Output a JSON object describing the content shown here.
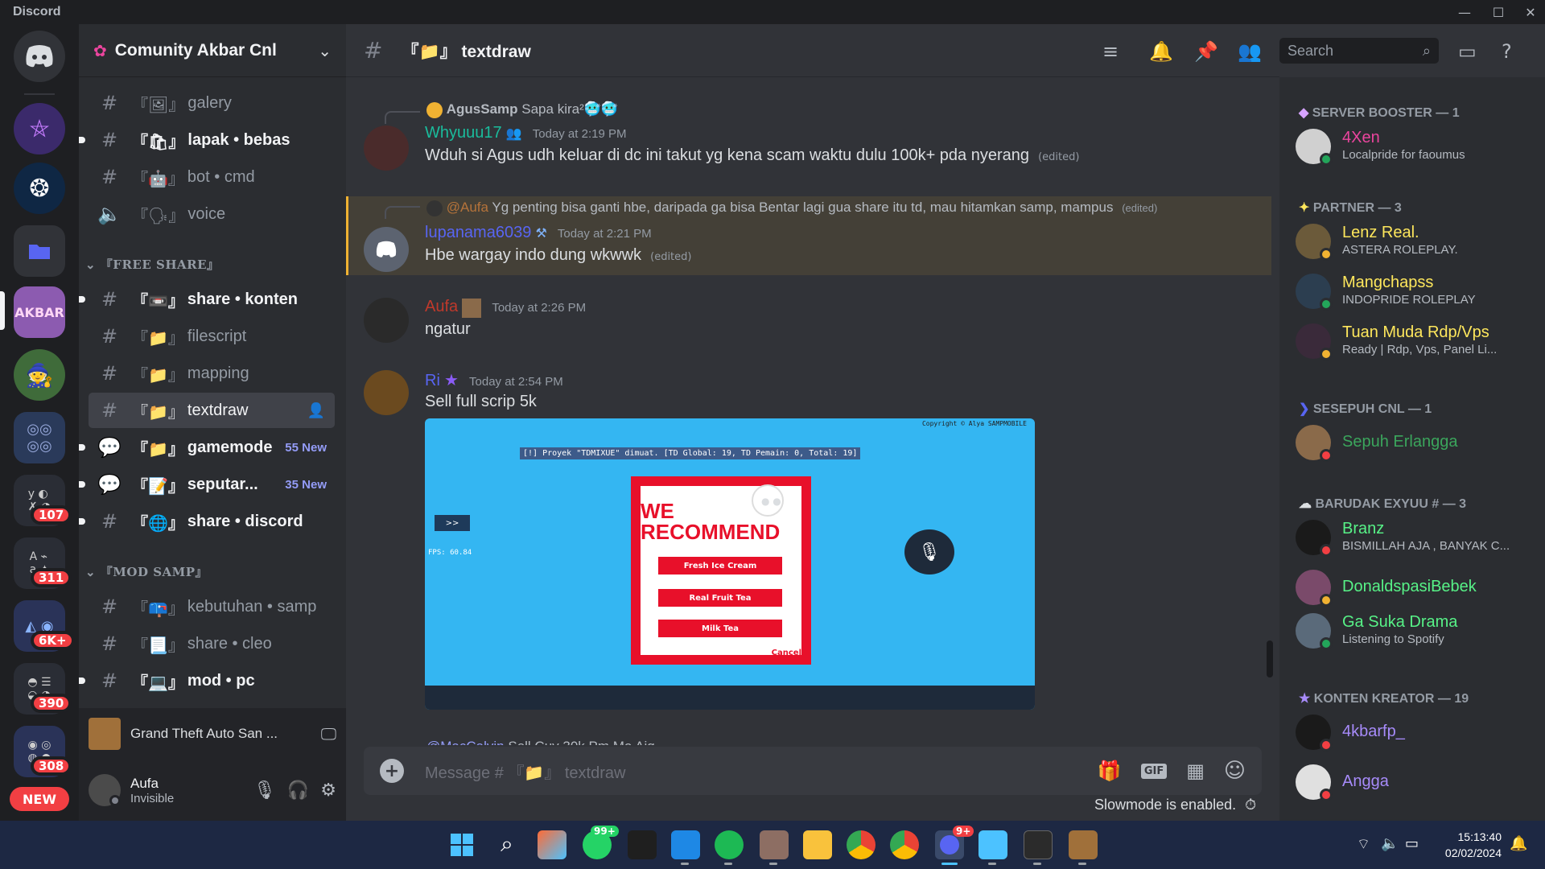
{
  "app_title": "Discord",
  "colors": {
    "accent": "#5865f2",
    "mention": "#f23f43",
    "online": "#23a55a",
    "idle": "#f0b232",
    "dnd": "#f23f43"
  },
  "rail_badges": [
    "107",
    "311",
    "6K+",
    "390",
    "308"
  ],
  "rail_new": "NEW",
  "guild": {
    "name": "Comunity Akbar Cnl"
  },
  "channels": [
    {
      "name": "galery",
      "prefix": "『🖼』",
      "type": "text",
      "state": "read"
    },
    {
      "name": "lapak • bebas",
      "prefix": "『🛍』",
      "type": "text",
      "state": "unread"
    },
    {
      "name": "bot • cmd",
      "prefix": "『🤖』",
      "type": "text",
      "state": "read"
    },
    {
      "name": "voice",
      "prefix": "『🗣』",
      "type": "voice",
      "state": "read"
    }
  ],
  "category_free": "『FREE SHARE』",
  "channels_free": [
    {
      "name": "share • konten",
      "prefix": "『📼』",
      "type": "text",
      "state": "unread"
    },
    {
      "name": "filescript",
      "prefix": "『📁』",
      "type": "text",
      "state": "read"
    },
    {
      "name": "mapping",
      "prefix": "『📁』",
      "type": "text",
      "state": "read"
    },
    {
      "name": "textdraw",
      "prefix": "『📁』",
      "type": "text",
      "state": "active"
    },
    {
      "name": "gamemode",
      "prefix": "『📁』",
      "type": "forum",
      "state": "unread",
      "badge": "55 New"
    },
    {
      "name": "seputar...",
      "prefix": "『📝』",
      "type": "forum",
      "state": "unread",
      "badge": "35 New"
    },
    {
      "name": "share • discord",
      "prefix": "『🌐』",
      "type": "text",
      "state": "unread"
    }
  ],
  "category_mod": "『MOD SAMP』",
  "channels_mod": [
    {
      "name": "kebutuhan • samp",
      "prefix": "『📪』",
      "type": "text",
      "state": "read"
    },
    {
      "name": "share • cleo",
      "prefix": "『📃』",
      "type": "text",
      "state": "read"
    },
    {
      "name": "mod • pc",
      "prefix": "『💻』",
      "type": "text",
      "state": "unread"
    }
  ],
  "activity": {
    "game": "Grand Theft Auto San ..."
  },
  "user": {
    "name": "Aufa",
    "status": "Invisible"
  },
  "chat": {
    "channel_title": "『📁』 textdraw",
    "search_placeholder": "Search",
    "composer_placeholder": "Message # 『📁』 textdraw",
    "slowmode": "Slowmode is enabled."
  },
  "messages": [
    {
      "reply_user": "AgusSamp",
      "reply_text": "Sapa kira²🥶🥶",
      "user": "Whyuuu17",
      "time": "Today at 2:19 PM",
      "text": "Wduh si Agus udh keluar di dc ini takut yg kena scam waktu dulu 100k+ pda nyerang",
      "edited": "(edited)"
    },
    {
      "reply_user": "@Aufa",
      "reply_text": "Yg penting bisa ganti hbe, daripada ga bisa Bentar lagi gua share itu td, mau hitamkan samp, mampus",
      "reply_edited": "(edited)",
      "user": "lupanama6039",
      "time": "Today at 2:21 PM",
      "text": "Hbe wargay indo dung wkwwk",
      "edited": "(edited)"
    },
    {
      "user": "Aufa",
      "time": "Today at 2:26 PM",
      "text": "ngatur"
    },
    {
      "user": "Ri",
      "time": "Today at 2:54 PM",
      "text": "Sell full scrip 5k",
      "image": {
        "project_line": "[!] Proyek \"TDMIXUE\" dimuat. [TD Global: 19, TD Pemain: 0, Total: 19]",
        "copyright": "Copyright © Alya SAMPMOBILE",
        "fps": "FPS: 60.84",
        "popup_title": "WE RECOMMEND",
        "options": [
          "Fresh Ice Cream",
          "Real Fruit Tea",
          "Milk Tea"
        ],
        "cancel": "Cancel",
        "nav": ">>"
      }
    },
    {
      "user": "@MacCalvin",
      "text": "Sell Cuy 30k Pm Mo Ajg"
    }
  ],
  "members": {
    "roles": [
      "SERVER BOOSTER — 1",
      "PARTNER — 3",
      "SESEPUH CNL — 1",
      "BARUDAK EXYUU # — 3",
      "KONTEN KREATOR — 19"
    ],
    "list": [
      {
        "name": "4Xen",
        "sub": "Localpride for faoumus",
        "color": "#eb459e",
        "status": "online"
      },
      {
        "name": "Lenz Real.",
        "sub": "ASTERA ROLEPLAY.",
        "color": "#fee75c",
        "status": "idle"
      },
      {
        "name": "Mangchapss",
        "sub": "INDOPRIDE ROLEPLAY",
        "color": "#fee75c",
        "status": "online"
      },
      {
        "name": "Tuan Muda Rdp/Vps",
        "sub": "Ready | Rdp, Vps, Panel Li...",
        "color": "#fee75c",
        "status": "idle"
      },
      {
        "name": "Sepuh Erlangga",
        "sub": "",
        "color": "#3ba55c",
        "status": "dnd"
      },
      {
        "name": "Branz",
        "sub": "BISMILLAH AJA , BANYAK C...",
        "color": "#57f287",
        "status": "dnd"
      },
      {
        "name": "DonaldspasiBebek",
        "sub": "",
        "color": "#57f287",
        "status": "idle"
      },
      {
        "name": "Ga Suka Drama",
        "sub": "Listening to Spotify",
        "color": "#57f287",
        "status": "online"
      },
      {
        "name": "4kbarfp_",
        "sub": "",
        "color": "#a78bfa",
        "status": "dnd"
      },
      {
        "name": "Angga",
        "sub": "",
        "color": "#a78bfa",
        "status": "dnd"
      }
    ]
  },
  "taskbar": {
    "time": "15:13:40",
    "date": "02/02/2024",
    "whatsapp_badge": "99+",
    "discord_badge": "9+"
  }
}
